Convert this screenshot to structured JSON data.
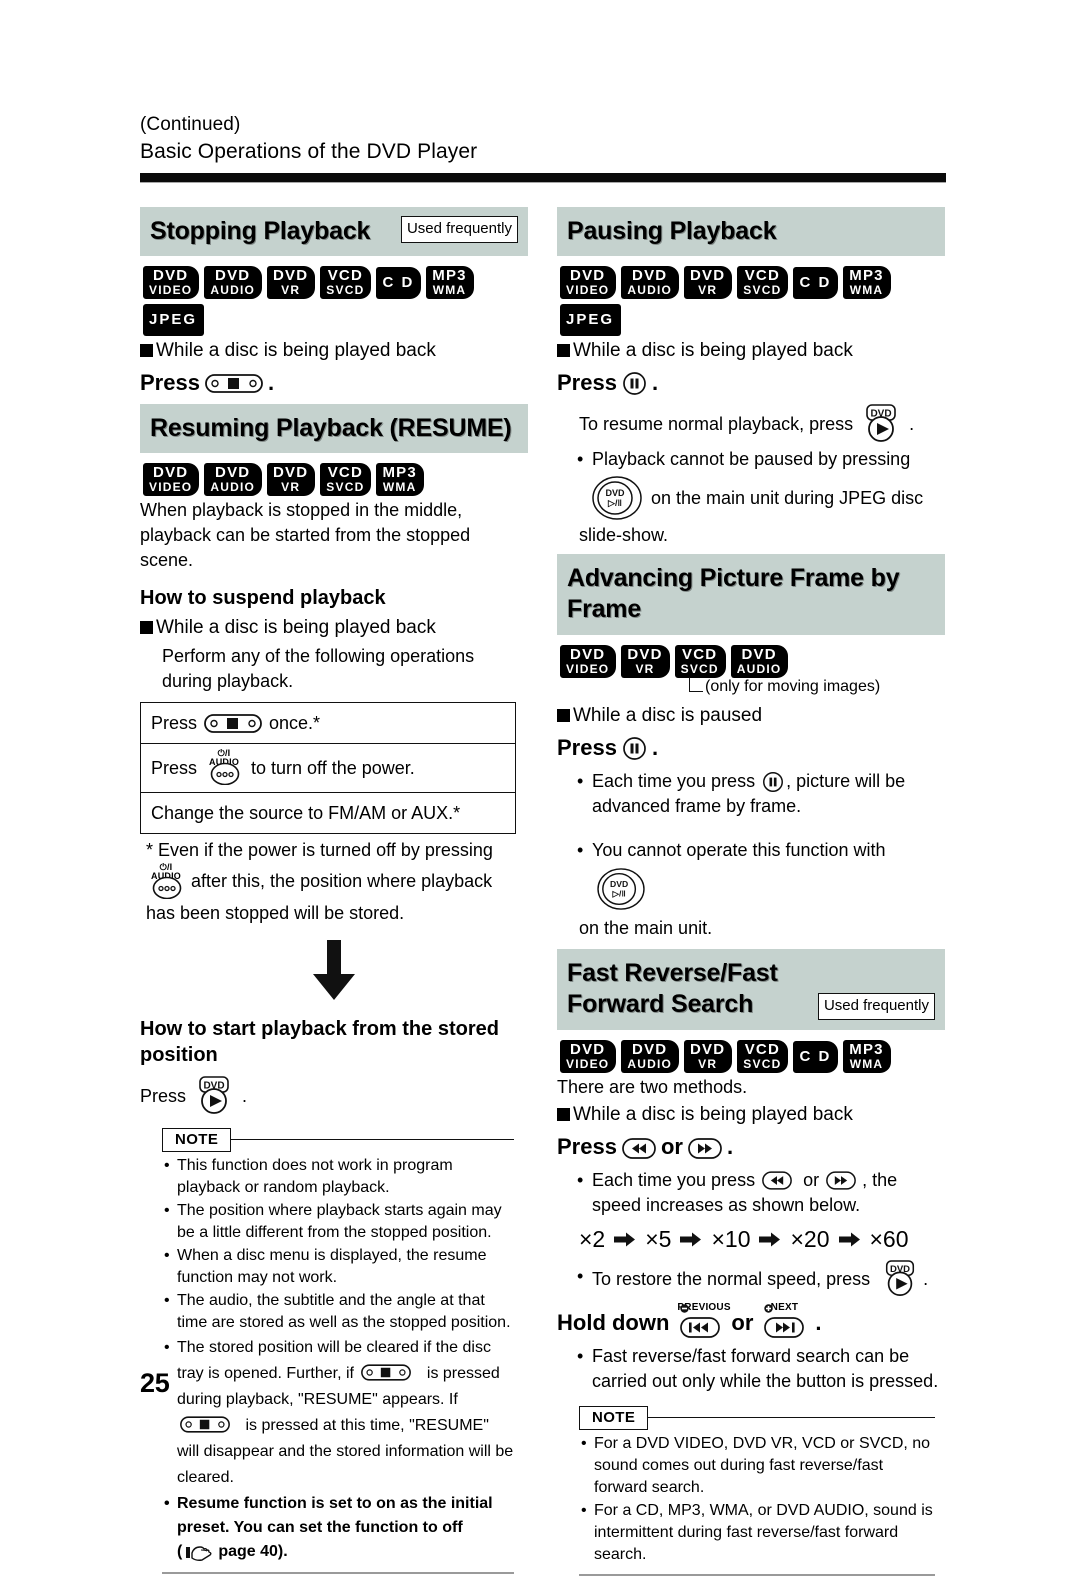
{
  "header": {
    "continued": "(Continued)",
    "title": "Basic Operations of the DVD Player"
  },
  "page_number": "25",
  "labels": {
    "used_frequently": "Used frequently",
    "note": "NOTE",
    "press": "Press",
    "hold_down": "Hold down",
    "or": "or"
  },
  "icons": {
    "stop": "stop-button-icon",
    "power": "power-audio-button-icon",
    "power_label": "⏻/I  AUDIO",
    "dvd_play": "dvd-play-button-icon",
    "dvd_play_label": "DVD",
    "pause": "pause-button-icon",
    "main_unit_dvd": "main-unit-dvd-play-pause-icon",
    "main_unit_label_top": "DVD",
    "main_unit_label_bottom": "▷/‖",
    "fast_reverse": "fast-reverse-button-icon",
    "fast_forward": "fast-forward-button-icon",
    "previous": "previous-skip-button-icon",
    "previous_label": "PREVIOUS",
    "next": "next-skip-button-icon",
    "next_label": "NEXT",
    "pointing_hand": "pointing-hand-icon",
    "down_arrow": "down-arrow-icon",
    "right_arrow": "right-arrow-icon"
  },
  "colors": {
    "band": "#c5d2ce",
    "badge_bg": "#000000",
    "rule": "#0a0a0a"
  },
  "left_column": {
    "stopping": {
      "heading": "Stopping Playback",
      "used_frequently": "Used frequently",
      "badges": [
        {
          "top": "DVD",
          "bottom": "VIDEO"
        },
        {
          "top": "DVD",
          "bottom": "AUDIO"
        },
        {
          "top": "DVD",
          "bottom": "VR"
        },
        {
          "top": "VCD",
          "bottom": "SVCD"
        },
        {
          "top": "C D",
          "bottom": ""
        },
        {
          "top": "MP3",
          "bottom": "WMA"
        },
        {
          "top": "JPEG",
          "bottom": ""
        }
      ],
      "condition": "While a disc is being played back",
      "press_suffix": "."
    },
    "resuming": {
      "heading": "Resuming Playback (RESUME)",
      "badges": [
        {
          "top": "DVD",
          "bottom": "VIDEO"
        },
        {
          "top": "DVD",
          "bottom": "AUDIO"
        },
        {
          "top": "DVD",
          "bottom": "VR"
        },
        {
          "top": "VCD",
          "bottom": "SVCD"
        },
        {
          "top": "MP3",
          "bottom": "WMA"
        }
      ],
      "intro": "When playback is stopped in the middle, playback can be started from the stopped scene.",
      "suspend_heading": "How to suspend playback",
      "suspend_condition": "While a disc is being played back",
      "suspend_intro": "Perform any of the following operations during playback.",
      "table_rows": [
        {
          "pre": "Press",
          "post": "once.*"
        },
        {
          "pre": "Press",
          "post": "to turn off the power."
        },
        {
          "pre": "Change the source to FM/AM or AUX.*",
          "post": ""
        }
      ],
      "footnote_part1": "* Even if the power is turned off by pressing",
      "footnote_part2": "after this, the position where playback",
      "footnote_part3": "has been stopped will be stored.",
      "start_heading": "How to start playback from the stored position",
      "start_press": "Press",
      "start_press_suffix": ".",
      "note_items": [
        "This function does not work in program playback or random playback.",
        "The position where playback starts again may be a little different from the stopped position.",
        "When a disc menu is displayed, the resume function may not work.",
        "The audio, the subtitle and the angle at that time are stored as well as the stopped position."
      ],
      "note_stored_part1": "The stored position will be cleared if the disc tray is opened. Further, if",
      "note_stored_part2": "is pressed during playback, \"RESUME\" appears. If",
      "note_stored_part3": "is pressed at this time, \"RESUME\" will disappear and the stored information will be cleared.",
      "note_bold_part1": "Resume function is set to on as the initial preset. You can set the function to off",
      "note_bold_part2": "(",
      "note_bold_part3": "page 40)."
    }
  },
  "right_column": {
    "pausing": {
      "heading": "Pausing Playback",
      "badges": [
        {
          "top": "DVD",
          "bottom": "VIDEO"
        },
        {
          "top": "DVD",
          "bottom": "AUDIO"
        },
        {
          "top": "DVD",
          "bottom": "VR"
        },
        {
          "top": "VCD",
          "bottom": "SVCD"
        },
        {
          "top": "C D",
          "bottom": ""
        },
        {
          "top": "MP3",
          "bottom": "WMA"
        },
        {
          "top": "JPEG",
          "bottom": ""
        }
      ],
      "condition": "While a disc is being played back",
      "press_suffix": ".",
      "resume_text": "To resume normal playback, press",
      "resume_suffix": ".",
      "bullet_part1": "Playback cannot be paused by pressing",
      "bullet_part2": "on the main unit during JPEG disc",
      "bullet_part3": "slide-show."
    },
    "advancing": {
      "heading": "Advancing Picture Frame by Frame",
      "badges": [
        {
          "top": "DVD",
          "bottom": "VIDEO"
        },
        {
          "top": "DVD",
          "bottom": "VR"
        },
        {
          "top": "VCD",
          "bottom": "SVCD"
        },
        {
          "top": "DVD",
          "bottom": "AUDIO"
        }
      ],
      "moving_note": "(only for moving images)",
      "condition": "While a disc is paused",
      "press_suffix": ".",
      "bullet1_part1": "Each time you press",
      "bullet1_part2": ", picture will be advanced frame by frame.",
      "bullet2_part1": "You cannot operate this function with",
      "bullet2_part2": "on the main unit."
    },
    "fastsearch": {
      "heading": "Fast Reverse/Fast Forward Search",
      "used_frequently": "Used frequently",
      "badges": [
        {
          "top": "DVD",
          "bottom": "VIDEO"
        },
        {
          "top": "DVD",
          "bottom": "AUDIO"
        },
        {
          "top": "DVD",
          "bottom": "VR"
        },
        {
          "top": "VCD",
          "bottom": "SVCD"
        },
        {
          "top": "C D",
          "bottom": ""
        },
        {
          "top": "MP3",
          "bottom": "WMA"
        }
      ],
      "methods": "There are two methods.",
      "condition": "While a disc is being played back",
      "press_mid": "or",
      "press_suffix": ".",
      "bullet1_part1": "Each time you press",
      "bullet1_mid": "or",
      "bullet1_part2": ", the speed increases as shown below.",
      "speeds": [
        "×2",
        "×5",
        "×10",
        "×20",
        "×60"
      ],
      "bullet2_part1": "To restore the normal speed, press",
      "bullet2_suffix": ".",
      "hold_mid": "or",
      "hold_suffix": ".",
      "bullet3": "Fast reverse/fast forward search can be carried out only while the button is pressed.",
      "note_items": [
        "For a DVD VIDEO, DVD VR, VCD or SVCD, no sound comes out during fast reverse/fast forward search.",
        "For a CD, MP3, WMA, or DVD AUDIO, sound is intermittent during fast reverse/fast forward search."
      ]
    }
  }
}
